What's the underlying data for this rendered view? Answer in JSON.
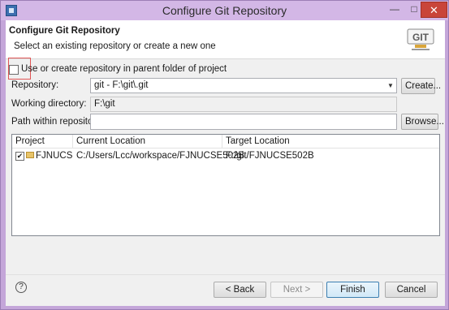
{
  "window": {
    "title": "Configure Git Repository"
  },
  "header": {
    "title": "Configure Git Repository",
    "description": "Select an existing repository or create a new one",
    "logo_text": "GIT"
  },
  "parent_folder_option": {
    "label": "Use or create repository in parent folder of project",
    "checked": false
  },
  "repository": {
    "label": "Repository:",
    "value": "git - F:\\git\\.git",
    "create_label": "Create..."
  },
  "working_directory": {
    "label": "Working directory:",
    "value": "F:\\git"
  },
  "path_within_repo": {
    "label": "Path within repository:",
    "value": "",
    "browse_label": "Browse..."
  },
  "table": {
    "columns": [
      "Project",
      "Current Location",
      "Target Location"
    ],
    "rows": [
      {
        "project": "FJNUCS...",
        "current": "C:/Users/Lcc/workspace/FJNUCSE502B",
        "target": "F:/git/FJNUCSE502B",
        "checked": true
      }
    ]
  },
  "buttons": {
    "back": "< Back",
    "next": "Next >",
    "finish": "Finish",
    "cancel": "Cancel"
  },
  "icons": {
    "help": "help-icon",
    "folder": "folder-icon",
    "git_logo": "git-logo-icon"
  },
  "colors": {
    "titlebar": "#d3b7e6",
    "close_button": "#c9453a",
    "highlight": "#e05555"
  }
}
